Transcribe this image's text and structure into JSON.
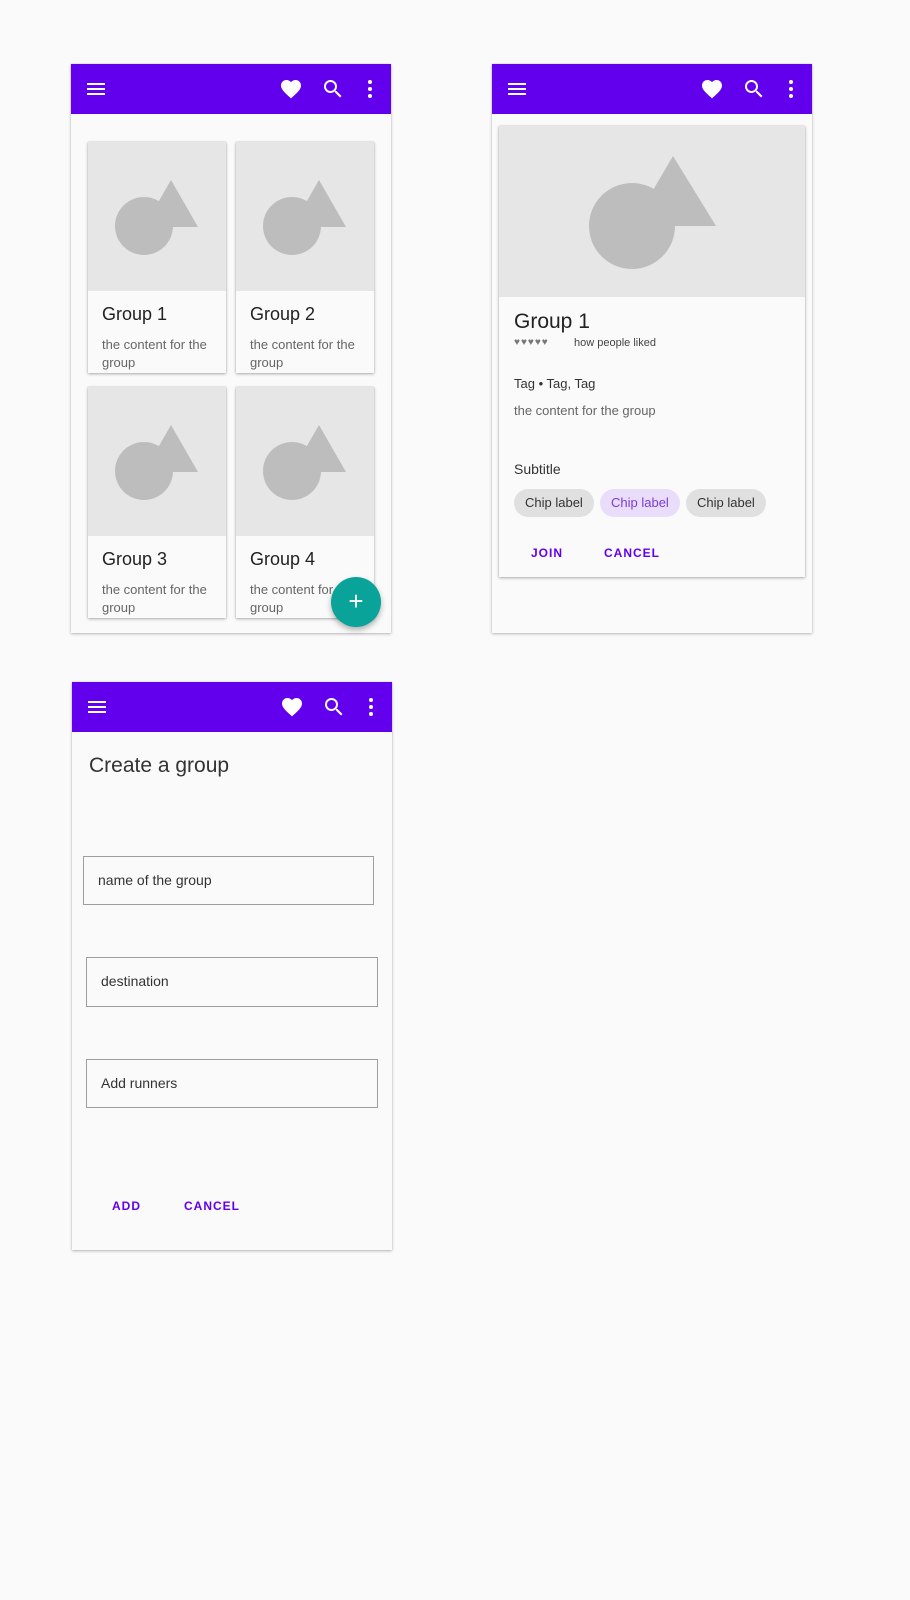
{
  "colors": {
    "primary": "#6200ee",
    "fab": "#0aa39a",
    "surface": "#fafafa",
    "media": "#e6e6e6"
  },
  "appbar": {
    "menu_icon": "menu-icon",
    "favorite_icon": "heart-icon",
    "search_icon": "search-icon",
    "more_icon": "more-vert-icon"
  },
  "groups_screen": {
    "cards": [
      {
        "title": "Group 1",
        "body": "the content for the group"
      },
      {
        "title": "Group 2",
        "body": "the content for the group"
      },
      {
        "title": "Group 3",
        "body": "the content for the group"
      },
      {
        "title": "Group 4",
        "body": "the content for the group"
      }
    ],
    "fab_label": "+"
  },
  "detail_screen": {
    "title": "Group 1",
    "rating_icons": "♥♥♥♥♥",
    "rating_caption": "how people liked",
    "tags": "Tag • Tag, Tag",
    "body": "the content for the group",
    "subtitle": "Subtitle",
    "chips": [
      {
        "label": "Chip label",
        "selected": false
      },
      {
        "label": "Chip label",
        "selected": true
      },
      {
        "label": "Chip label",
        "selected": false
      }
    ],
    "join_label": "JOIN",
    "cancel_label": "CANCEL"
  },
  "create_screen": {
    "title": "Create a group",
    "fields": {
      "name": "name of the group",
      "destination": "destination",
      "runners": "Add runners"
    },
    "add_label": "ADD",
    "cancel_label": "CANCEL"
  }
}
